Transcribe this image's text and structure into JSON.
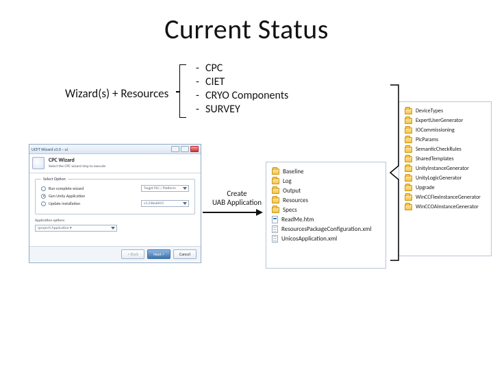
{
  "title": "Current Status",
  "wizard_label": "Wizard(s) + Resources",
  "wizard_items": [
    "CPC",
    "CIET",
    "CRYO Components",
    "SURVEY"
  ],
  "create_label_line1": "Create",
  "create_label_line2": "UAB Application",
  "dialog": {
    "window_title": "UCFT Wizard v3.0 – ui",
    "heading": "CPC Wizard",
    "subheading": "Select the CPC wizard step to execute",
    "fieldset_legend": "Select Option",
    "radio1": "Run complete wizard",
    "combo1": "Target PLC / Platform",
    "radio2_checked": "Gen Unity Application",
    "radio3": "Update installation",
    "combo2": "v1.23build15",
    "lower_label": "Application options",
    "lower_combo": "(project) Application ▾",
    "btn_back": "< Back",
    "btn_next": "Next >",
    "btn_cancel": "Cancel"
  },
  "pane_mid": [
    {
      "type": "folder",
      "name": "Baseline"
    },
    {
      "type": "folder",
      "name": "Log"
    },
    {
      "type": "folder",
      "name": "Output"
    },
    {
      "type": "folder",
      "name": "Resources"
    },
    {
      "type": "folder",
      "name": "Specs"
    },
    {
      "type": "html",
      "name": "ReadMe.htm"
    },
    {
      "type": "xml",
      "name": "ResourcesPackageConfiguration.xml"
    },
    {
      "type": "xml",
      "name": "UnicosApplication.xml"
    }
  ],
  "pane_right": [
    {
      "type": "folder",
      "name": "DeviceTypes"
    },
    {
      "type": "folder",
      "name": "ExpertUserGenerator"
    },
    {
      "type": "folder",
      "name": "IOCommissioning"
    },
    {
      "type": "folder",
      "name": "PlcParams"
    },
    {
      "type": "folder",
      "name": "SemanticCheckRules"
    },
    {
      "type": "folder",
      "name": "SharedTemplates"
    },
    {
      "type": "folder",
      "name": "UnityInstanceGenerator"
    },
    {
      "type": "folder",
      "name": "UnityLogicGenerator"
    },
    {
      "type": "folder",
      "name": "Upgrade"
    },
    {
      "type": "folder",
      "name": "WinCCFlexInstanceGenerator"
    },
    {
      "type": "folder",
      "name": "WinCCOAInstanceGenerator"
    }
  ]
}
